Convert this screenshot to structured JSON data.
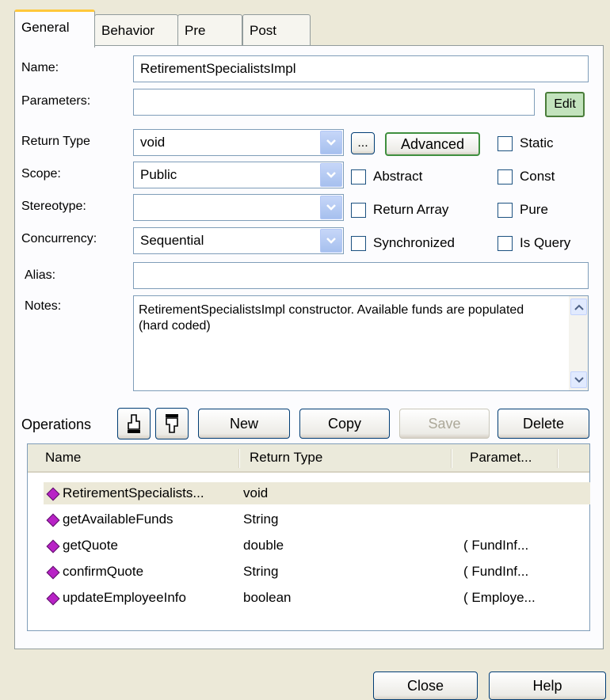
{
  "tabs": [
    "General",
    "Behavior",
    "Pre",
    "Post"
  ],
  "labels": {
    "name": "Name:",
    "parameters": "Parameters:",
    "return_type": "Return Type",
    "scope": "Scope:",
    "stereotype": "Stereotype:",
    "concurrency": "Concurrency:",
    "alias": "Alias:",
    "notes": "Notes:",
    "operations": "Operations"
  },
  "fields": {
    "name": "RetirementSpecialistsImpl",
    "parameters": "",
    "return_type": "void",
    "scope": "Public",
    "stereotype": "",
    "concurrency": "Sequential",
    "alias": "",
    "notes": "RetirementSpecialistsImpl constructor.  Available funds are populated (hard coded)"
  },
  "buttons": {
    "edit": "Edit",
    "ellipsis": "...",
    "advanced": "Advanced",
    "new": "New",
    "copy": "Copy",
    "save": "Save",
    "delete": "Delete",
    "close": "Close",
    "help": "Help"
  },
  "checkboxes": {
    "static": "Static",
    "abstract": "Abstract",
    "const": "Const",
    "return_array": "Return Array",
    "pure": "Pure",
    "synchronized": "Synchronized",
    "is_query": "Is Query"
  },
  "operations_table": {
    "columns": [
      "Name",
      "Return Type",
      "Paramet..."
    ],
    "rows": [
      {
        "name": "RetirementSpecialists...",
        "return_type": "void",
        "params": ""
      },
      {
        "name": "getAvailableFunds",
        "return_type": "String",
        "params": ""
      },
      {
        "name": "getQuote",
        "return_type": "double",
        "params": "( FundInf..."
      },
      {
        "name": "confirmQuote",
        "return_type": "String",
        "params": "( FundInf..."
      },
      {
        "name": "updateEmployeeInfo",
        "return_type": "boolean",
        "params": "( Employe..."
      }
    ]
  },
  "icons": {
    "move_up": "hand-up-icon",
    "move_down": "hand-down-icon",
    "operation": "operation-diamond-icon"
  },
  "colors": {
    "dialog_bg": "#ECE9D8",
    "operation_icon": "#B822C6",
    "tab_highlight": "#FFC83C"
  }
}
